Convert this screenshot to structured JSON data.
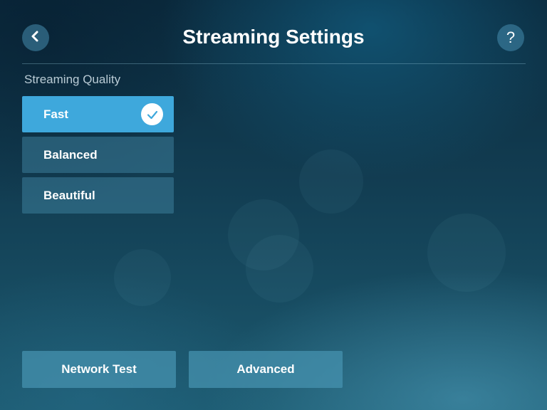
{
  "header": {
    "title": "Streaming Settings",
    "back_icon": "chevron-left-icon",
    "help_label": "?"
  },
  "streaming_quality": {
    "label": "Streaming Quality",
    "options": [
      {
        "label": "Fast",
        "selected": true
      },
      {
        "label": "Balanced",
        "selected": false
      },
      {
        "label": "Beautiful",
        "selected": false
      }
    ],
    "selected_icon": "checkmark-icon"
  },
  "footer": {
    "network_test_label": "Network Test",
    "advanced_label": "Advanced"
  },
  "colors": {
    "accent": "#3ea8dc",
    "option_bg": "#3c7d9b",
    "background": "#0e3448"
  }
}
